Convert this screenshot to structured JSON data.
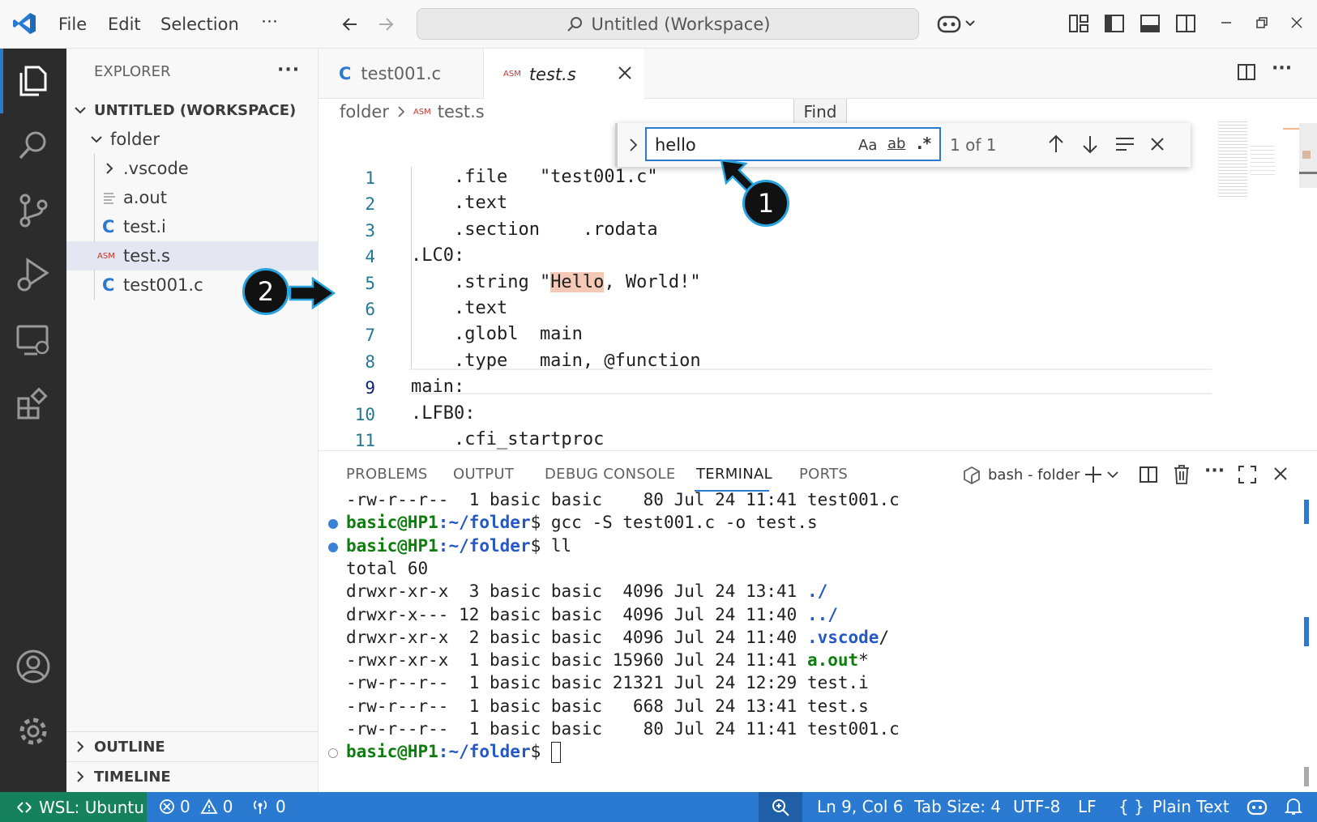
{
  "titlebar": {
    "menu": [
      "File",
      "Edit",
      "Selection",
      "⋯"
    ],
    "search_text": "Untitled (Workspace)"
  },
  "sidebar": {
    "title": "EXPLORER",
    "more": "···",
    "workspace": "UNTITLED (WORKSPACE)",
    "folder": "folder",
    "items": [
      {
        "label": ".vscode",
        "icon": "chevron-right-icon"
      },
      {
        "label": "a.out",
        "icon": "file-lines-icon"
      },
      {
        "label": "test.i",
        "icon": "c-lang-icon",
        "icon_text": "C"
      },
      {
        "label": "test.s",
        "icon": "asm-icon",
        "icon_text": "ASM",
        "selected": true
      },
      {
        "label": "test001.c",
        "icon": "c-lang-icon",
        "icon_text": "C"
      }
    ],
    "outline": "OUTLINE",
    "timeline": "TIMELINE"
  },
  "tabs": [
    {
      "label": "test001.c",
      "icon_text": "C",
      "active": false
    },
    {
      "label": "test.s",
      "icon_text": "ASM",
      "active": true
    }
  ],
  "breadcrumb": {
    "folder": "folder",
    "file": "test.s",
    "file_icon": "ASM"
  },
  "find": {
    "tooltip": "Find",
    "value": "hello",
    "match_case": "Aa",
    "whole_word": "ab",
    "regex": ".*",
    "count": "1 of 1"
  },
  "editor": {
    "lines": [
      {
        "n": "1",
        "text": "    .file   \"test001.c\""
      },
      {
        "n": "2",
        "text": "    .text"
      },
      {
        "n": "3",
        "text": "    .section    .rodata"
      },
      {
        "n": "4",
        "text": ".LC0:"
      },
      {
        "n": "5",
        "pre": "    .string \"",
        "hl": "Hello",
        "post": ", World!\""
      },
      {
        "n": "6",
        "text": "    .text"
      },
      {
        "n": "7",
        "text": "    .globl  main"
      },
      {
        "n": "8",
        "text": "    .type   main, @function"
      },
      {
        "n": "9",
        "text": "main:"
      },
      {
        "n": "10",
        "text": ".LFB0:"
      },
      {
        "n": "11",
        "text": "    .cfi_startproc"
      }
    ],
    "highlight_color": "#f5c9b5"
  },
  "panel": {
    "tabs": [
      "PROBLEMS",
      "OUTPUT",
      "DEBUG CONSOLE",
      "TERMINAL",
      "PORTS"
    ],
    "active_tab": "TERMINAL",
    "shell": "bash - folder"
  },
  "terminal": {
    "lines": [
      {
        "type": "out",
        "text": "-rw-r--r--  1 basic basic    80 Jul 24 11:41 test001.c"
      },
      {
        "type": "cmd",
        "user": "basic@HP1",
        "path": ":~/folder",
        "cmd": "$ gcc -S test001.c -o test.s"
      },
      {
        "type": "cmd",
        "user": "basic@HP1",
        "path": ":~/folder",
        "cmd": "$ ll"
      },
      {
        "type": "out",
        "text": "total 60"
      },
      {
        "type": "ls",
        "pre": "drwxr-xr-x  3 basic basic  4096 Jul 24 13:41 ",
        "name": "./",
        "kind": "dir"
      },
      {
        "type": "ls",
        "pre": "drwxr-x--- 12 basic basic  4096 Jul 24 11:40 ",
        "name": "../",
        "kind": "dir"
      },
      {
        "type": "ls",
        "pre": "drwxr-xr-x  2 basic basic  4096 Jul 24 11:40 ",
        "name": ".vscode",
        "suffix": "/",
        "kind": "dir"
      },
      {
        "type": "ls",
        "pre": "-rwxr-xr-x  1 basic basic 15960 Jul 24 11:41 ",
        "name": "a.out",
        "suffix": "*",
        "kind": "exec"
      },
      {
        "type": "out",
        "text": "-rw-r--r--  1 basic basic 21321 Jul 24 12:29 test.i"
      },
      {
        "type": "out",
        "text": "-rw-r--r--  1 basic basic   668 Jul 24 13:41 test.s"
      },
      {
        "type": "out",
        "text": "-rw-r--r--  1 basic basic    80 Jul 24 11:41 test001.c"
      },
      {
        "type": "prompt",
        "user": "basic@HP1",
        "path": ":~/folder",
        "cmd": "$ "
      }
    ]
  },
  "status": {
    "remote": "WSL: Ubuntu",
    "errors": "0",
    "warnings": "0",
    "ports": "0",
    "position": "Ln 9, Col 6",
    "tab_size": "Tab Size: 4",
    "encoding": "UTF-8",
    "eol": "LF",
    "language": "Plain Text",
    "language_icon": "{ }"
  },
  "callouts": [
    "1",
    "2"
  ],
  "colors": {
    "accent": "#2a7ad1",
    "activity_bg": "#2c2c2c",
    "remote_bg": "#16825d",
    "callout_border": "#27a3e0"
  }
}
